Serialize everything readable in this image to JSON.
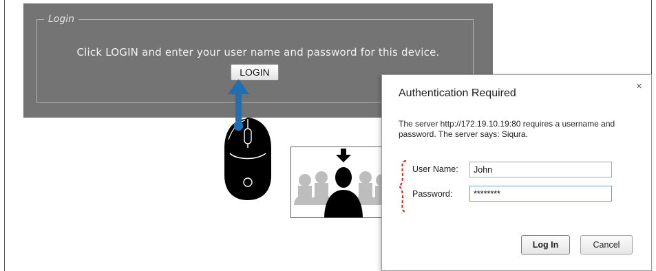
{
  "login_panel": {
    "legend": "Login",
    "message": "Click LOGIN and enter your user name and password for this device.",
    "button_label": "LOGIN"
  },
  "auth_dialog": {
    "title": "Authentication Required",
    "close_glyph": "×",
    "message": "The server http://172.19.10.19:80 requires a username and password. The server says: Siqura.",
    "username_label": "User Name:",
    "username_value": "John",
    "password_label": "Password:",
    "password_value": "********",
    "login_button": "Log In",
    "cancel_button": "Cancel"
  },
  "colors": {
    "panel_bg": "#747474",
    "arrow": "#1f6fb2",
    "brace": "#d12a2a"
  },
  "icons": [
    "mouse-icon",
    "up-arrow-icon",
    "down-arrow-icon",
    "person-group-icon",
    "close-icon"
  ]
}
